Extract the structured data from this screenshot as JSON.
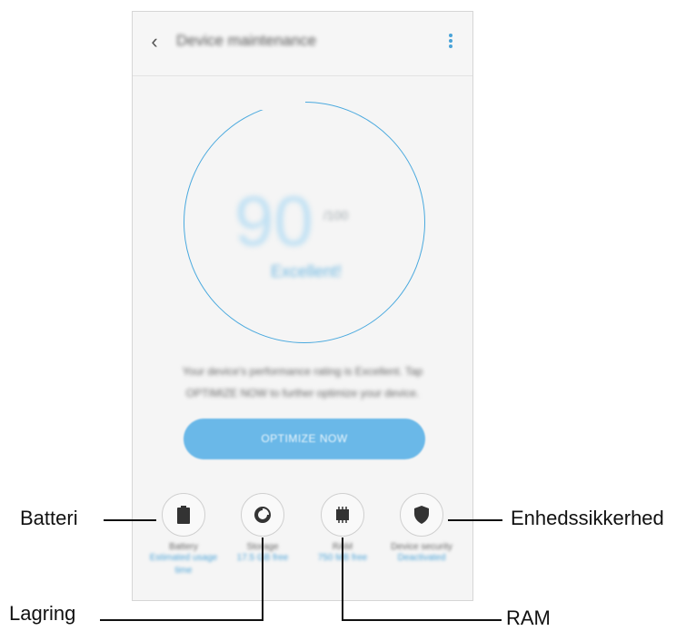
{
  "appbar": {
    "title": "Device maintenance"
  },
  "score": {
    "value": "90",
    "max": "/100",
    "status": "Excellent!"
  },
  "description": {
    "line1": "Your device's performance rating is Excellent. Tap",
    "line2": "OPTIMIZE NOW to further optimize your device."
  },
  "optimize_button": {
    "label": "OPTIMIZE NOW"
  },
  "categories": [
    {
      "name": "Battery",
      "value": "Estimated usage",
      "value2": "time"
    },
    {
      "name": "Storage",
      "value": "17.5 GB free"
    },
    {
      "name": "RAM",
      "value": "750 MB free"
    },
    {
      "name": "Device security",
      "value": "Deactivated"
    }
  ],
  "callouts": {
    "battery": "Batteri",
    "storage": "Lagring",
    "ram": "RAM",
    "security": "Enhedssikkerhed"
  },
  "colors": {
    "accent": "#4aa9de",
    "button": "#6ab8e8",
    "score": "#bfe0f3"
  }
}
